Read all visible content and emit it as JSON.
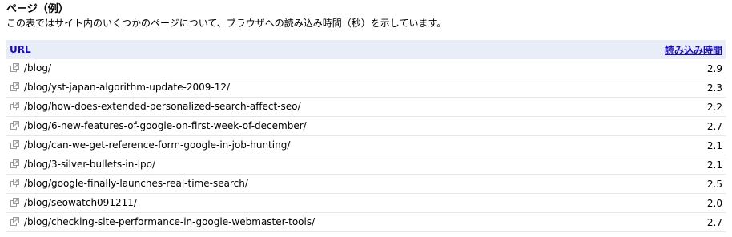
{
  "section": {
    "title": "ページ（例）",
    "description": "この表ではサイト内のいくつかのページについて、ブラウザへの読み込み時間（秒）を示しています。"
  },
  "table": {
    "headers": {
      "url": "URL",
      "load_time": "読み込み時間"
    },
    "rows": [
      {
        "url": "/blog/",
        "time": "2.9"
      },
      {
        "url": "/blog/yst-japan-algorithm-update-2009-12/",
        "time": "2.3"
      },
      {
        "url": "/blog/how-does-extended-personalized-search-affect-seo/",
        "time": "2.2"
      },
      {
        "url": "/blog/6-new-features-of-google-on-first-week-of-december/",
        "time": "2.7"
      },
      {
        "url": "/blog/can-we-get-reference-form-google-in-job-hunting/",
        "time": "2.1"
      },
      {
        "url": "/blog/3-silver-bullets-in-lpo/",
        "time": "2.1"
      },
      {
        "url": "/blog/google-finally-launches-real-time-search/",
        "time": "2.5"
      },
      {
        "url": "/blog/seowatch091211/",
        "time": "2.0"
      },
      {
        "url": "/blog/checking-site-performance-in-google-webmaster-tools/",
        "time": "2.7"
      }
    ],
    "row_icon": "external-link-icon"
  },
  "colors": {
    "header_background": "#e8edf7",
    "link": "#1a0dab",
    "row_divider": "#e6e6e6",
    "icon": "#9a9a9a"
  }
}
